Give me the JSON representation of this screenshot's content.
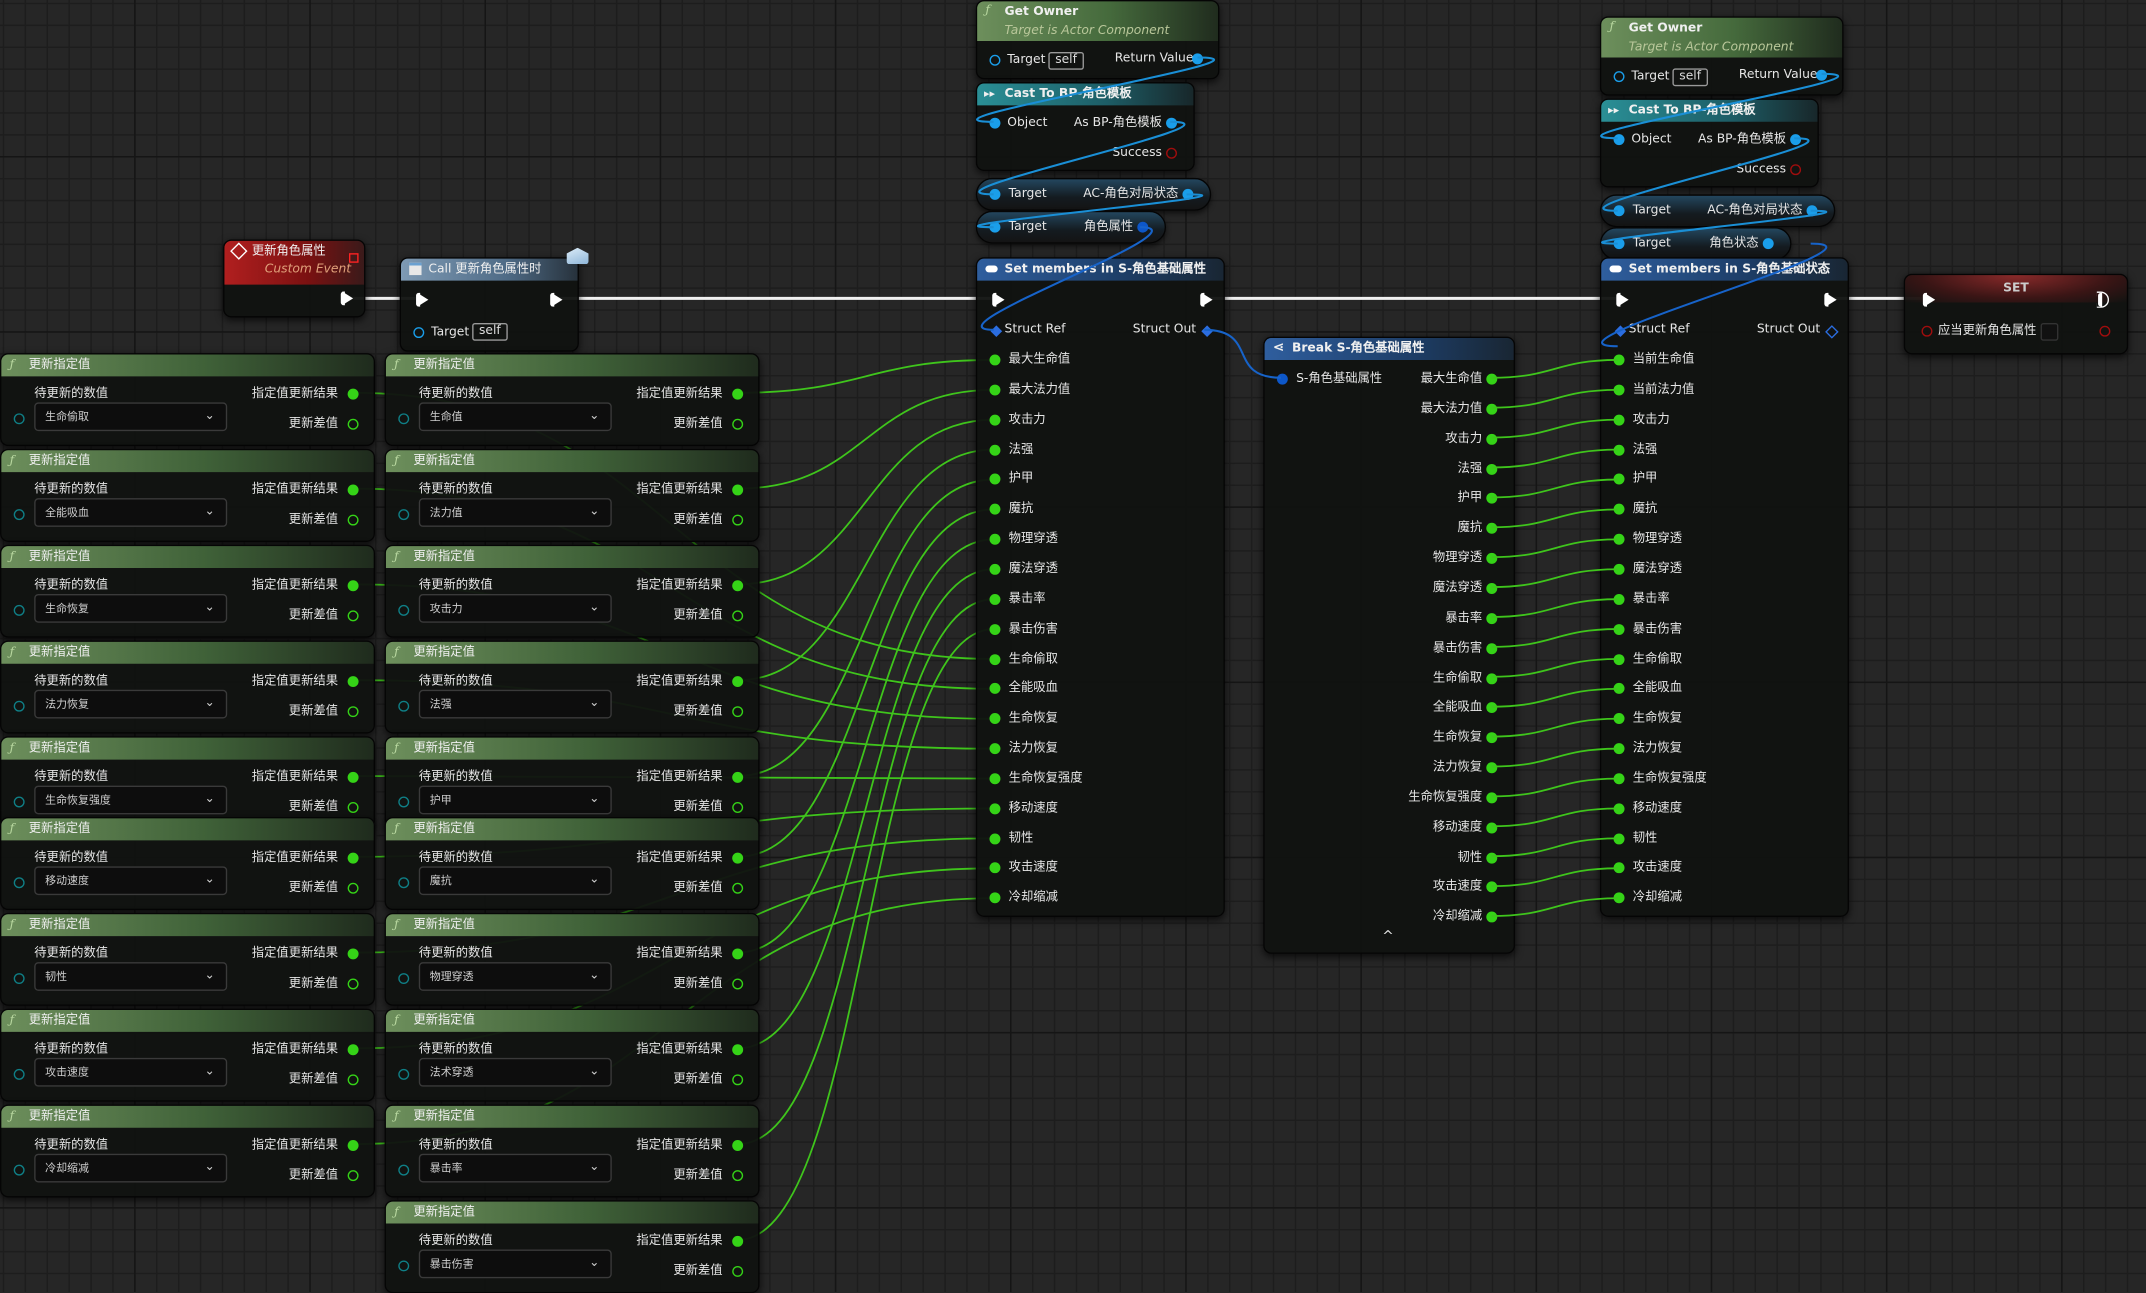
{
  "custom_event": {
    "title": "更新角色属性",
    "subtitle": "Custom Event"
  },
  "call_node": {
    "title": "Call 更新角色属性时",
    "target_label": "Target",
    "target_value": "self"
  },
  "get_owner": [
    {
      "title": "Get Owner",
      "subtitle": "Target is Actor Component",
      "target_label": "Target",
      "target_value": "self",
      "return_label": "Return Value"
    },
    {
      "title": "Get Owner",
      "subtitle": "Target is Actor Component",
      "target_label": "Target",
      "target_value": "self",
      "return_label": "Return Value"
    }
  ],
  "cast": [
    {
      "title": "Cast To BP-角色模板",
      "object_label": "Object",
      "as_label": "As BP-角色模板",
      "success_label": "Success"
    },
    {
      "title": "Cast To BP-角色模板",
      "object_label": "Object",
      "as_label": "As BP-角色模板",
      "success_label": "Success"
    }
  ],
  "getters": [
    [
      {
        "target": "Target",
        "value": "AC-角色对局状态"
      },
      {
        "target": "Target",
        "value": "角色属性"
      }
    ],
    [
      {
        "target": "Target",
        "value": "AC-角色对局状态"
      },
      {
        "target": "Target",
        "value": "角色状态"
      }
    ]
  ],
  "set_members": [
    {
      "title": "Set members in S-角色基础属性",
      "struct_ref": "Struct Ref",
      "struct_out": "Struct Out",
      "pins": [
        "最大生命值",
        "最大法力值",
        "攻击力",
        "法强",
        "护甲",
        "魔抗",
        "物理穿透",
        "魔法穿透",
        "暴击率",
        "暴击伤害",
        "生命偷取",
        "全能吸血",
        "生命恢复",
        "法力恢复",
        "生命恢复强度",
        "移动速度",
        "韧性",
        "攻击速度",
        "冷却缩减"
      ]
    },
    {
      "title": "Set members in S-角色基础状态",
      "struct_ref": "Struct Ref",
      "struct_out": "Struct Out",
      "pins": [
        "当前生命值",
        "当前法力值",
        "攻击力",
        "法强",
        "护甲",
        "魔抗",
        "物理穿透",
        "魔法穿透",
        "暴击率",
        "暴击伤害",
        "生命偷取",
        "全能吸血",
        "生命恢复",
        "法力恢复",
        "生命恢复强度",
        "移动速度",
        "韧性",
        "攻击速度",
        "冷却缩减"
      ]
    }
  ],
  "break_node": {
    "title": "Break S-角色基础属性",
    "input": "S-角色基础属性",
    "pins": [
      "最大生命值",
      "最大法力值",
      "攻击力",
      "法强",
      "护甲",
      "魔抗",
      "物理穿透",
      "魔法穿透",
      "暴击率",
      "暴击伤害",
      "生命偷取",
      "全能吸血",
      "生命恢复",
      "法力恢复",
      "生命恢复强度",
      "移动速度",
      "韧性",
      "攻击速度",
      "冷却缩减"
    ],
    "collapse_icon": "^"
  },
  "set_node": {
    "title": "SET",
    "var_label": "应当更新角色属性",
    "value": false
  },
  "update_nodes": {
    "title": "更新指定值",
    "input_label": "待更新的数值",
    "result_label": "指定值更新结果",
    "delta_label": "更新差值",
    "chevron": "⌄",
    "columns": [
      [
        "生命偷取",
        "全能吸血",
        "生命恢复",
        "法力恢复",
        "生命恢复强度",
        "移动速度",
        "韧性",
        "攻击速度",
        "冷却缩减"
      ],
      [
        "生命值",
        "法力值",
        "攻击力",
        "法强",
        "护甲",
        "魔抗",
        "物理穿透",
        "法术穿透",
        "暴击率",
        "暴击伤害"
      ]
    ]
  },
  "colors": {
    "float_pin": "#35d317",
    "object_pin": "#1a9eea",
    "bool_pin": "#a00d0d",
    "exec": "#ffffff"
  }
}
